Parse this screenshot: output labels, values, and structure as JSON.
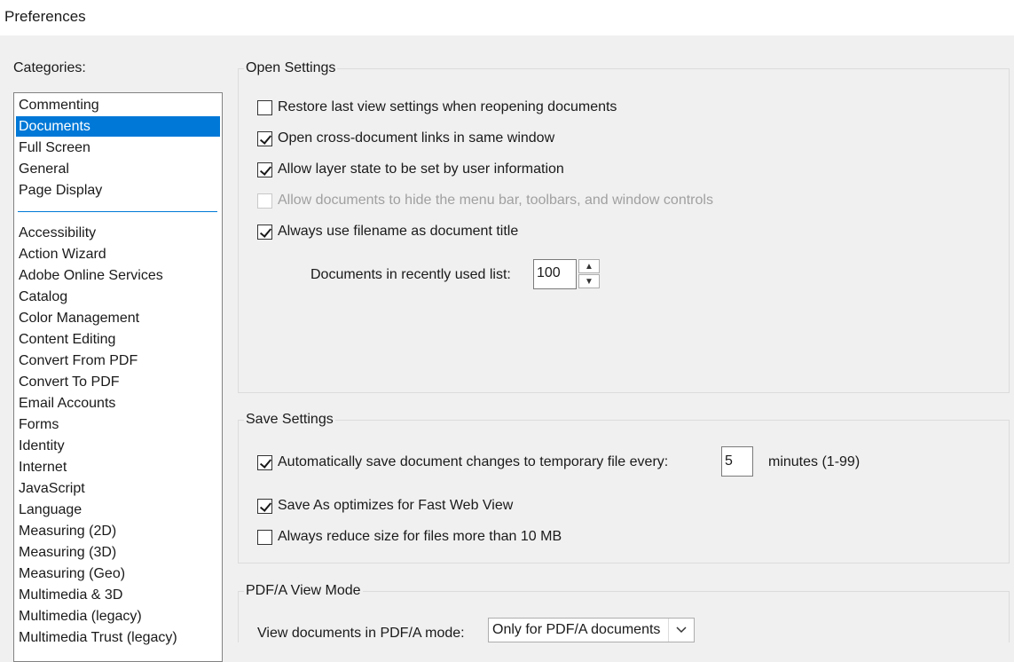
{
  "window": {
    "title": "Preferences"
  },
  "categories": {
    "label": "Categories:",
    "top_items": [
      "Commenting",
      "Documents",
      "Full Screen",
      "General",
      "Page Display"
    ],
    "items": [
      "Accessibility",
      "Action Wizard",
      "Adobe Online Services",
      "Catalog",
      "Color Management",
      "Content Editing",
      "Convert From PDF",
      "Convert To PDF",
      "Email Accounts",
      "Forms",
      "Identity",
      "Internet",
      "JavaScript",
      "Language",
      "Measuring (2D)",
      "Measuring (3D)",
      "Measuring (Geo)",
      "Multimedia & 3D",
      "Multimedia (legacy)",
      "Multimedia Trust (legacy)"
    ],
    "selected": "Documents"
  },
  "open_settings": {
    "title": "Open Settings",
    "restore_view": {
      "label": "Restore last view settings when reopening documents",
      "checked": false
    },
    "cross_doc_links": {
      "label": "Open cross-document links in same window",
      "checked": true
    },
    "layer_state": {
      "label": "Allow layer state to be set by user information",
      "checked": true
    },
    "hide_menu": {
      "label": "Allow documents to hide the menu bar, toolbars, and window controls",
      "checked": false,
      "disabled": true
    },
    "filename_title": {
      "label": "Always use filename as document title",
      "checked": true
    },
    "recent_list": {
      "label": "Documents in recently used list:",
      "value": "100"
    }
  },
  "save_settings": {
    "title": "Save Settings",
    "auto_save": {
      "label": "Automatically save document changes to temporary file every:",
      "checked": true,
      "value": "5",
      "unit": "minutes (1-99)"
    },
    "fast_web": {
      "label": "Save As optimizes for Fast Web View",
      "checked": true
    },
    "reduce_size": {
      "label": "Always reduce size for files more than 10 MB",
      "checked": false
    }
  },
  "pdfa": {
    "title": "PDF/A View Mode",
    "view_mode": {
      "label": "View documents in PDF/A mode:",
      "value": "Only for PDF/A documents"
    }
  }
}
